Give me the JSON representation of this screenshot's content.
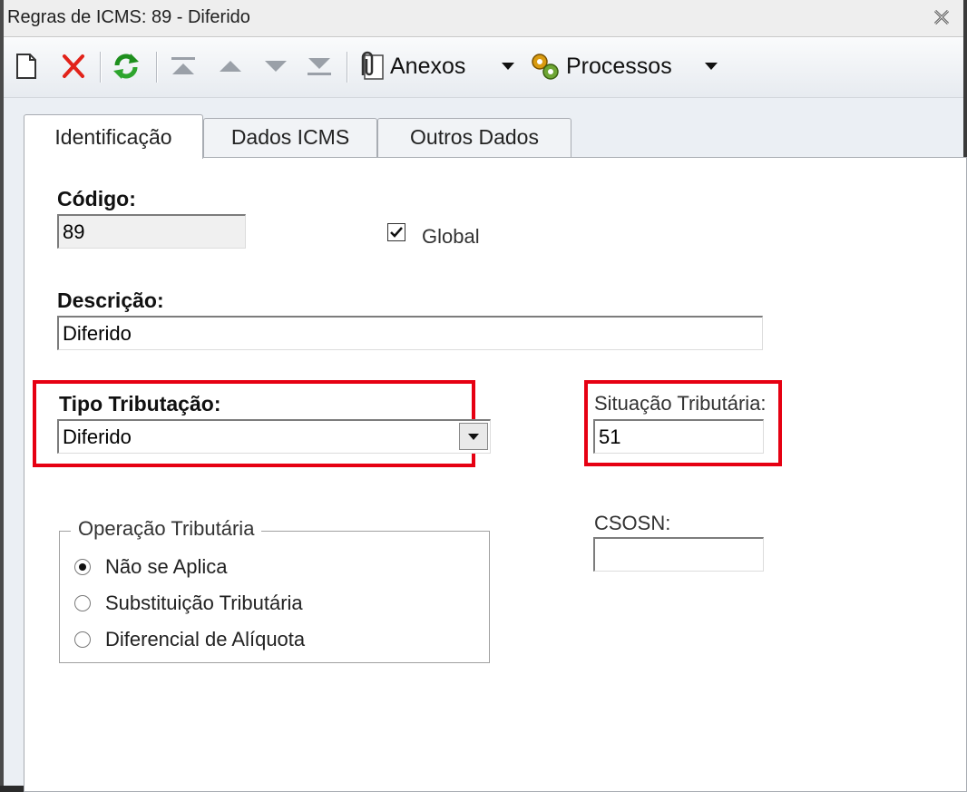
{
  "window": {
    "title": "Regras de ICMS: 89 - Diferido"
  },
  "toolbar": {
    "new_icon": "document-icon",
    "delete_icon": "red-x-icon",
    "refresh_icon": "green-refresh-icon",
    "anexos_label": "Anexos",
    "processos_label": "Processos"
  },
  "tabs": [
    {
      "label": "Identificação",
      "active": true
    },
    {
      "label": "Dados ICMS",
      "active": false
    },
    {
      "label": "Outros Dados",
      "active": false
    }
  ],
  "form": {
    "codigo_label": "Código:",
    "codigo_value": "89",
    "global_label": "Global",
    "global_checked": true,
    "descricao_label": "Descrição:",
    "descricao_value": "Diferido",
    "tipo_tributacao_label": "Tipo Tributação:",
    "tipo_tributacao_value": "Diferido",
    "situacao_tributaria_label": "Situação Tributária:",
    "situacao_tributaria_value": "51",
    "csosn_label": "CSOSN:",
    "csosn_value": "",
    "operacao_tributaria": {
      "title": "Operação Tributária",
      "options": [
        {
          "label": "Não se Aplica",
          "selected": true
        },
        {
          "label": "Substituição Tributária",
          "selected": false
        },
        {
          "label": "Diferencial de Alíquota",
          "selected": false
        }
      ]
    }
  },
  "colors": {
    "highlight": "#e60012",
    "window_bg": "#ebeff4"
  }
}
